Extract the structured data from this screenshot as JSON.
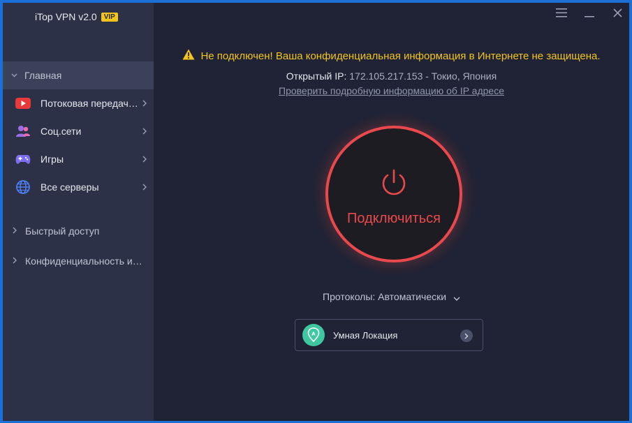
{
  "app": {
    "title": "iTop VPN v2.0",
    "badge": "VIP"
  },
  "window_controls": {
    "menu_icon": "hamburger-icon",
    "minimize_icon": "minimize-icon",
    "close_icon": "close-icon"
  },
  "sidebar": {
    "home": {
      "label": "Главная",
      "icon": "chevron-down-icon"
    },
    "items": [
      {
        "label": "Потоковая передач…",
        "icon": "youtube-play-icon",
        "color": "#e83a3a"
      },
      {
        "label": "Соц.сети",
        "icon": "people-icon",
        "color": "#9b6ee8"
      },
      {
        "label": "Игры",
        "icon": "gamepad-icon",
        "color": "#7d6ef0"
      },
      {
        "label": "Все серверы",
        "icon": "globe-icon",
        "color": "#4f7df0"
      }
    ],
    "sections": [
      {
        "label": "Быстрый доступ"
      },
      {
        "label": "Конфиденциальность и …"
      }
    ]
  },
  "status": {
    "warning": "Не подключен! Ваша конфиденциальная информация  в Интернете не защищена.",
    "ip_label": "Открытый IP:",
    "ip_value": "172.105.217.153 - Токио, Япония",
    "ip_link": "Проверить подробную информацию об IP адресе"
  },
  "connect": {
    "label": "Подключиться"
  },
  "protocol": {
    "label": "Протоколы: Автоматически"
  },
  "location": {
    "label": "Умная Локация"
  },
  "colors": {
    "accent": "#e9494d",
    "warning": "#f3c41c",
    "background": "#1f2335",
    "sidebar": "#2c3147"
  }
}
